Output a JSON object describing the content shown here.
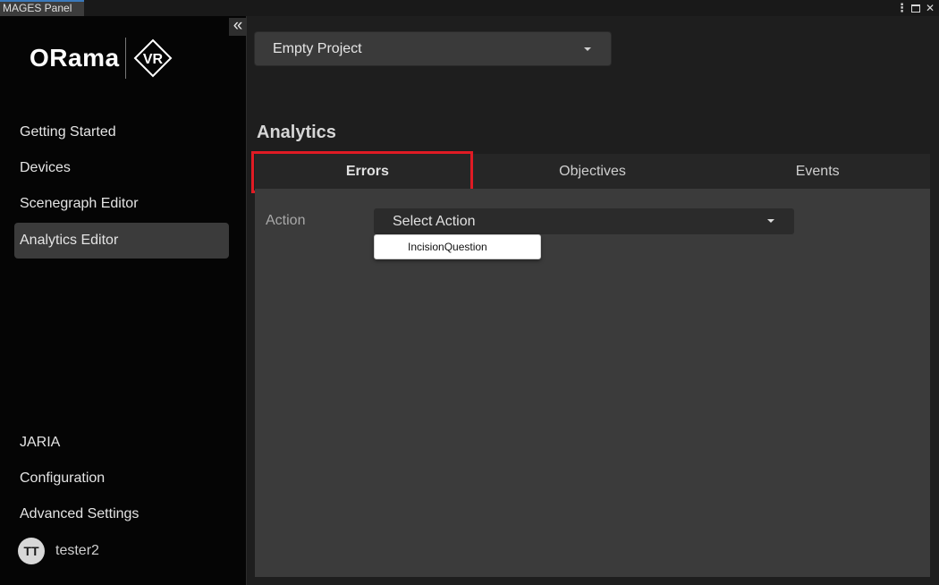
{
  "window": {
    "tab_title": "MAGES Panel",
    "controls": {
      "menu": "⋮",
      "close": "✕"
    }
  },
  "sidebar": {
    "collapse_icon": "double-chevron-left-icon",
    "logo": {
      "text": "ORama",
      "mark": "VR"
    },
    "nav_top": [
      {
        "label": "Getting Started"
      },
      {
        "label": "Devices"
      },
      {
        "label": "Scenegraph Editor"
      },
      {
        "label": "Analytics Editor",
        "active": true
      }
    ],
    "nav_bottom": [
      {
        "label": "JARIA"
      },
      {
        "label": "Configuration"
      },
      {
        "label": "Advanced Settings"
      }
    ],
    "user": {
      "initials": "TT",
      "name": "tester2"
    }
  },
  "main": {
    "project_select": {
      "value": "Empty Project"
    },
    "section_title": "Analytics",
    "tabs": [
      {
        "label": "Errors",
        "active": true
      },
      {
        "label": "Objectives"
      },
      {
        "label": "Events"
      }
    ],
    "highlight_color": "#e01b24",
    "action_field": {
      "label": "Action",
      "value": "Select Action",
      "options": [
        "IncisionQuestion"
      ]
    }
  }
}
